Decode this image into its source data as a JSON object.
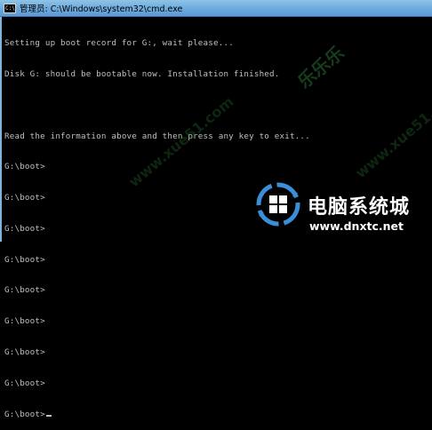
{
  "window": {
    "title": "管理员: C:\\Windows\\system32\\cmd.exe",
    "icon": "cmd-icon",
    "icon_text": "C:\\"
  },
  "console": {
    "lines": [
      "Setting up boot record for G:, wait please...",
      "Disk G: should be bootable now. Installation finished.",
      "",
      "Read the information above and then press any key to exit...",
      "G:\\boot>",
      "G:\\boot>",
      "G:\\boot>",
      "G:\\boot>",
      "G:\\boot>",
      "G:\\boot>",
      "G:\\boot>",
      "G:\\boot>",
      "G:\\boot>"
    ]
  },
  "watermarks": {
    "site_cn": "乐乐乐",
    "site_url": "www.xue51.com"
  },
  "brand": {
    "name": "电脑系统城",
    "url": "www.dnxtc.net",
    "colors": {
      "ring": "#3a8fd8",
      "accent": "#1f6fbf"
    }
  }
}
